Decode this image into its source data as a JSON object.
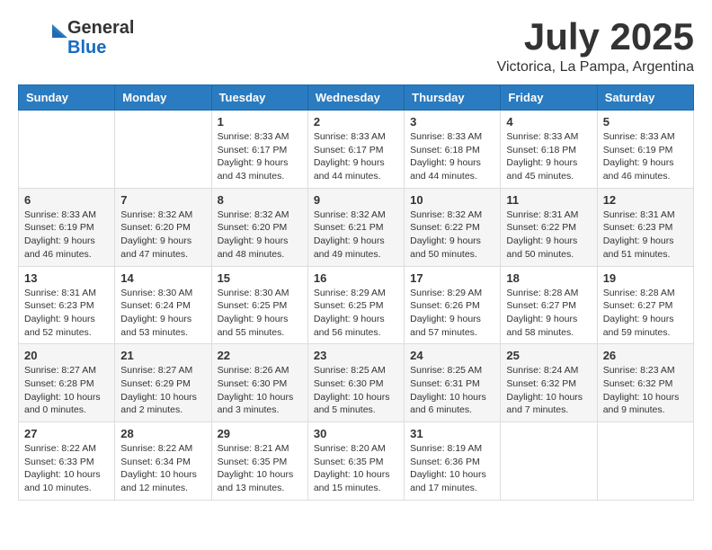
{
  "header": {
    "logo_general": "General",
    "logo_blue": "Blue",
    "title": "July 2025",
    "location": "Victorica, La Pampa, Argentina"
  },
  "calendar": {
    "days_of_week": [
      "Sunday",
      "Monday",
      "Tuesday",
      "Wednesday",
      "Thursday",
      "Friday",
      "Saturday"
    ],
    "weeks": [
      [
        {
          "day": "",
          "info": ""
        },
        {
          "day": "",
          "info": ""
        },
        {
          "day": "1",
          "info": "Sunrise: 8:33 AM\nSunset: 6:17 PM\nDaylight: 9 hours and 43 minutes."
        },
        {
          "day": "2",
          "info": "Sunrise: 8:33 AM\nSunset: 6:17 PM\nDaylight: 9 hours and 44 minutes."
        },
        {
          "day": "3",
          "info": "Sunrise: 8:33 AM\nSunset: 6:18 PM\nDaylight: 9 hours and 44 minutes."
        },
        {
          "day": "4",
          "info": "Sunrise: 8:33 AM\nSunset: 6:18 PM\nDaylight: 9 hours and 45 minutes."
        },
        {
          "day": "5",
          "info": "Sunrise: 8:33 AM\nSunset: 6:19 PM\nDaylight: 9 hours and 46 minutes."
        }
      ],
      [
        {
          "day": "6",
          "info": "Sunrise: 8:33 AM\nSunset: 6:19 PM\nDaylight: 9 hours and 46 minutes."
        },
        {
          "day": "7",
          "info": "Sunrise: 8:32 AM\nSunset: 6:20 PM\nDaylight: 9 hours and 47 minutes."
        },
        {
          "day": "8",
          "info": "Sunrise: 8:32 AM\nSunset: 6:20 PM\nDaylight: 9 hours and 48 minutes."
        },
        {
          "day": "9",
          "info": "Sunrise: 8:32 AM\nSunset: 6:21 PM\nDaylight: 9 hours and 49 minutes."
        },
        {
          "day": "10",
          "info": "Sunrise: 8:32 AM\nSunset: 6:22 PM\nDaylight: 9 hours and 50 minutes."
        },
        {
          "day": "11",
          "info": "Sunrise: 8:31 AM\nSunset: 6:22 PM\nDaylight: 9 hours and 50 minutes."
        },
        {
          "day": "12",
          "info": "Sunrise: 8:31 AM\nSunset: 6:23 PM\nDaylight: 9 hours and 51 minutes."
        }
      ],
      [
        {
          "day": "13",
          "info": "Sunrise: 8:31 AM\nSunset: 6:23 PM\nDaylight: 9 hours and 52 minutes."
        },
        {
          "day": "14",
          "info": "Sunrise: 8:30 AM\nSunset: 6:24 PM\nDaylight: 9 hours and 53 minutes."
        },
        {
          "day": "15",
          "info": "Sunrise: 8:30 AM\nSunset: 6:25 PM\nDaylight: 9 hours and 55 minutes."
        },
        {
          "day": "16",
          "info": "Sunrise: 8:29 AM\nSunset: 6:25 PM\nDaylight: 9 hours and 56 minutes."
        },
        {
          "day": "17",
          "info": "Sunrise: 8:29 AM\nSunset: 6:26 PM\nDaylight: 9 hours and 57 minutes."
        },
        {
          "day": "18",
          "info": "Sunrise: 8:28 AM\nSunset: 6:27 PM\nDaylight: 9 hours and 58 minutes."
        },
        {
          "day": "19",
          "info": "Sunrise: 8:28 AM\nSunset: 6:27 PM\nDaylight: 9 hours and 59 minutes."
        }
      ],
      [
        {
          "day": "20",
          "info": "Sunrise: 8:27 AM\nSunset: 6:28 PM\nDaylight: 10 hours and 0 minutes."
        },
        {
          "day": "21",
          "info": "Sunrise: 8:27 AM\nSunset: 6:29 PM\nDaylight: 10 hours and 2 minutes."
        },
        {
          "day": "22",
          "info": "Sunrise: 8:26 AM\nSunset: 6:30 PM\nDaylight: 10 hours and 3 minutes."
        },
        {
          "day": "23",
          "info": "Sunrise: 8:25 AM\nSunset: 6:30 PM\nDaylight: 10 hours and 5 minutes."
        },
        {
          "day": "24",
          "info": "Sunrise: 8:25 AM\nSunset: 6:31 PM\nDaylight: 10 hours and 6 minutes."
        },
        {
          "day": "25",
          "info": "Sunrise: 8:24 AM\nSunset: 6:32 PM\nDaylight: 10 hours and 7 minutes."
        },
        {
          "day": "26",
          "info": "Sunrise: 8:23 AM\nSunset: 6:32 PM\nDaylight: 10 hours and 9 minutes."
        }
      ],
      [
        {
          "day": "27",
          "info": "Sunrise: 8:22 AM\nSunset: 6:33 PM\nDaylight: 10 hours and 10 minutes."
        },
        {
          "day": "28",
          "info": "Sunrise: 8:22 AM\nSunset: 6:34 PM\nDaylight: 10 hours and 12 minutes."
        },
        {
          "day": "29",
          "info": "Sunrise: 8:21 AM\nSunset: 6:35 PM\nDaylight: 10 hours and 13 minutes."
        },
        {
          "day": "30",
          "info": "Sunrise: 8:20 AM\nSunset: 6:35 PM\nDaylight: 10 hours and 15 minutes."
        },
        {
          "day": "31",
          "info": "Sunrise: 8:19 AM\nSunset: 6:36 PM\nDaylight: 10 hours and 17 minutes."
        },
        {
          "day": "",
          "info": ""
        },
        {
          "day": "",
          "info": ""
        }
      ]
    ]
  }
}
